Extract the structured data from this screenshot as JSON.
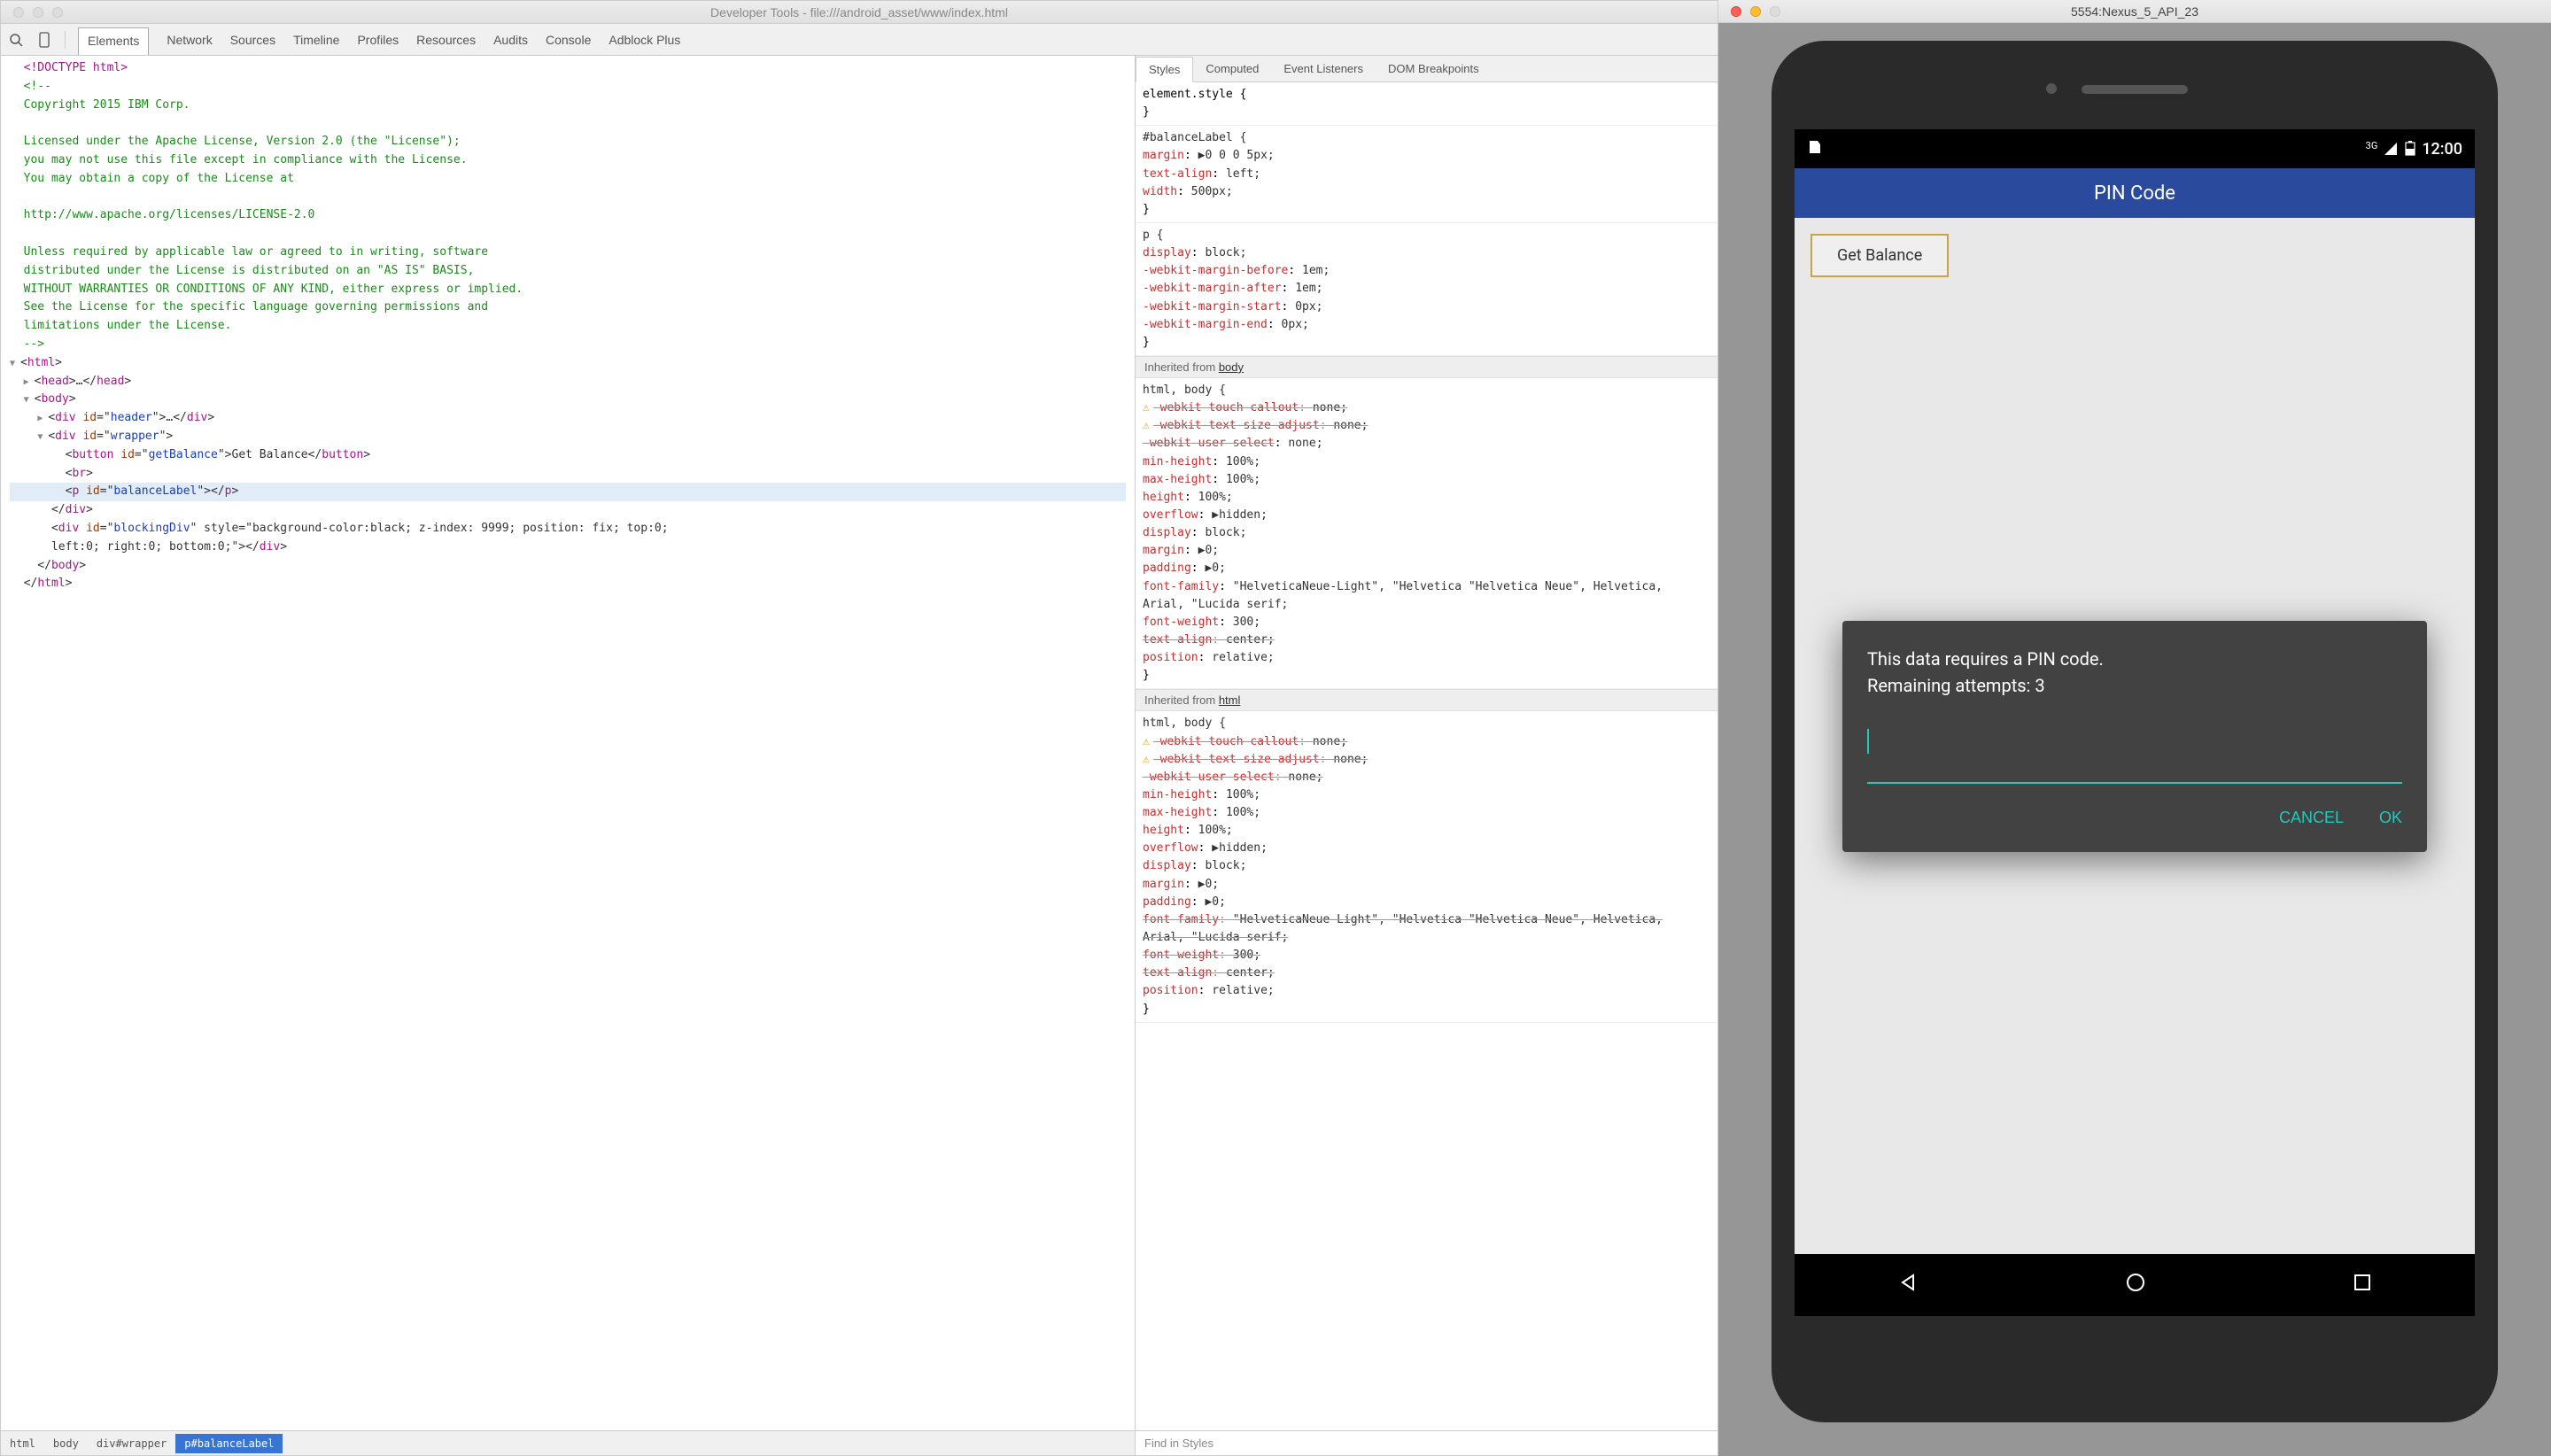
{
  "devtools": {
    "title": "Developer Tools - file:///android_asset/www/index.html",
    "tabs": [
      "Elements",
      "Network",
      "Sources",
      "Timeline",
      "Profiles",
      "Resources",
      "Audits",
      "Console",
      "Adblock Plus"
    ],
    "active_tab": "Elements",
    "dom": {
      "doctype": "<!DOCTYPE html>",
      "comment_lines": [
        "<!--",
        "Copyright 2015 IBM Corp.",
        "",
        "Licensed under the Apache License, Version 2.0 (the \"License\");",
        "you may not use this file except in compliance with the License.",
        "You may obtain a copy of the License at",
        "",
        "http://www.apache.org/licenses/LICENSE-2.0",
        "",
        "Unless required by applicable law or agreed to in writing, software",
        "distributed under the License is distributed on an \"AS IS\" BASIS,",
        "WITHOUT WARRANTIES OR CONDITIONS OF ANY KIND, either express or implied.",
        "See the License for the specific language governing permissions and",
        "limitations under the License.",
        "-->"
      ],
      "nodes": {
        "html_open": "<html>",
        "head": "<head>…</head>",
        "body_open": "<body>",
        "header": "<div id=\"header\">…</div>",
        "wrapper_open": "<div id=\"wrapper\">",
        "button": "<button id=\"getBalance\">Get Balance</button>",
        "br": "<br>",
        "balance_p": "<p id=\"balanceLabel\"></p>",
        "wrapper_close": "</div>",
        "blocking": "<div id=\"blockingDiv\" style=\"background-color:black; z-index: 9999; position: fix; top:0;\nleft:0; right:0; bottom:0;\"></div>",
        "body_close": "</body>",
        "html_close": "</html>"
      }
    },
    "breadcrumbs": [
      "html",
      "body",
      "div#wrapper",
      "p#balanceLabel"
    ],
    "styles": {
      "tabs": [
        "Styles",
        "Computed",
        "Event Listeners",
        "DOM Breakpoints"
      ],
      "active_tab": "Styles",
      "element_style": "element.style {\n}",
      "rules": [
        {
          "selector": "#balanceLabel {",
          "props": [
            {
              "p": "margin",
              "v": "▶0 0 0 5px;",
              "tri": true
            },
            {
              "p": "text-align",
              "v": "left;"
            },
            {
              "p": "width",
              "v": "500px;"
            }
          ],
          "close": "}"
        },
        {
          "selector": "p {",
          "props": [
            {
              "p": "display",
              "v": "block;"
            },
            {
              "p": "-webkit-margin-before",
              "v": "1em;"
            },
            {
              "p": "-webkit-margin-after",
              "v": "1em;"
            },
            {
              "p": "-webkit-margin-start",
              "v": "0px;"
            },
            {
              "p": "-webkit-margin-end",
              "v": "0px;"
            }
          ],
          "close": "}"
        }
      ],
      "inherited_body_header": "Inherited from body",
      "inherited_html_header": "Inherited from html",
      "html_body_rule": {
        "selector": "html, body {",
        "props": [
          {
            "p": "-webkit-touch-callout",
            "v": "none;",
            "strike": true,
            "warn": true
          },
          {
            "p": "-webkit-text-size-adjust",
            "v": "none;",
            "strike": true,
            "warn": true
          },
          {
            "p": "-webkit-user-select",
            "v": "none;",
            "strike_prop_only": true
          },
          {
            "p": "min-height",
            "v": "100%;"
          },
          {
            "p": "max-height",
            "v": "100%;"
          },
          {
            "p": "height",
            "v": "100%;"
          },
          {
            "p": "overflow",
            "v": "▶hidden;",
            "tri": true
          },
          {
            "p": "display",
            "v": "block;"
          },
          {
            "p": "margin",
            "v": "▶0;",
            "tri": true
          },
          {
            "p": "padding",
            "v": "▶0;",
            "tri": true
          },
          {
            "p": "font-family",
            "v": "\"HelveticaNeue-Light\", \"Helvetica\n    \"Helvetica Neue\", Helvetica, Arial, \"Lucida\n    serif;"
          },
          {
            "p": "font-weight",
            "v": "300;"
          },
          {
            "p": "text-align",
            "v": "center;",
            "strike": true
          },
          {
            "p": "position",
            "v": "relative;"
          }
        ],
        "close": "}"
      },
      "html_rule_2": {
        "selector": "html, body {",
        "props": [
          {
            "p": "-webkit-touch-callout",
            "v": "none;",
            "strike": true,
            "warn": true
          },
          {
            "p": "-webkit-text-size-adjust",
            "v": "none;",
            "strike": true,
            "warn": true
          },
          {
            "p": "-webkit-user-select",
            "v": "none;",
            "strike": true
          },
          {
            "p": "min-height",
            "v": "100%;"
          },
          {
            "p": "max-height",
            "v": "100%;"
          },
          {
            "p": "height",
            "v": "100%;"
          },
          {
            "p": "overflow",
            "v": "▶hidden;",
            "tri": true
          },
          {
            "p": "display",
            "v": "block;"
          },
          {
            "p": "margin",
            "v": "▶0;",
            "tri": true
          },
          {
            "p": "padding",
            "v": "▶0;",
            "tri": true
          },
          {
            "p": "font-family",
            "v": "\"HelveticaNeue-Light\", \"Helvetica\n    \"Helvetica Neue\", Helvetica, Arial, \"Lucida\n    serif;",
            "strike": true
          },
          {
            "p": "font-weight",
            "v": "300;",
            "strike": true
          },
          {
            "p": "text-align",
            "v": "center;",
            "strike": true
          },
          {
            "p": "position",
            "v": "relative;"
          }
        ],
        "close": "}"
      },
      "find_placeholder": "Find in Styles"
    }
  },
  "emulator": {
    "title": "5554:Nexus_5_API_23",
    "status": {
      "signal": "3G",
      "time": "12:00"
    },
    "app": {
      "title": "PIN Code",
      "button": "Get Balance",
      "dialog": {
        "line1": "This data requires a PIN code.",
        "line2": "Remaining attempts: 3",
        "cancel": "CANCEL",
        "ok": "OK"
      }
    }
  }
}
